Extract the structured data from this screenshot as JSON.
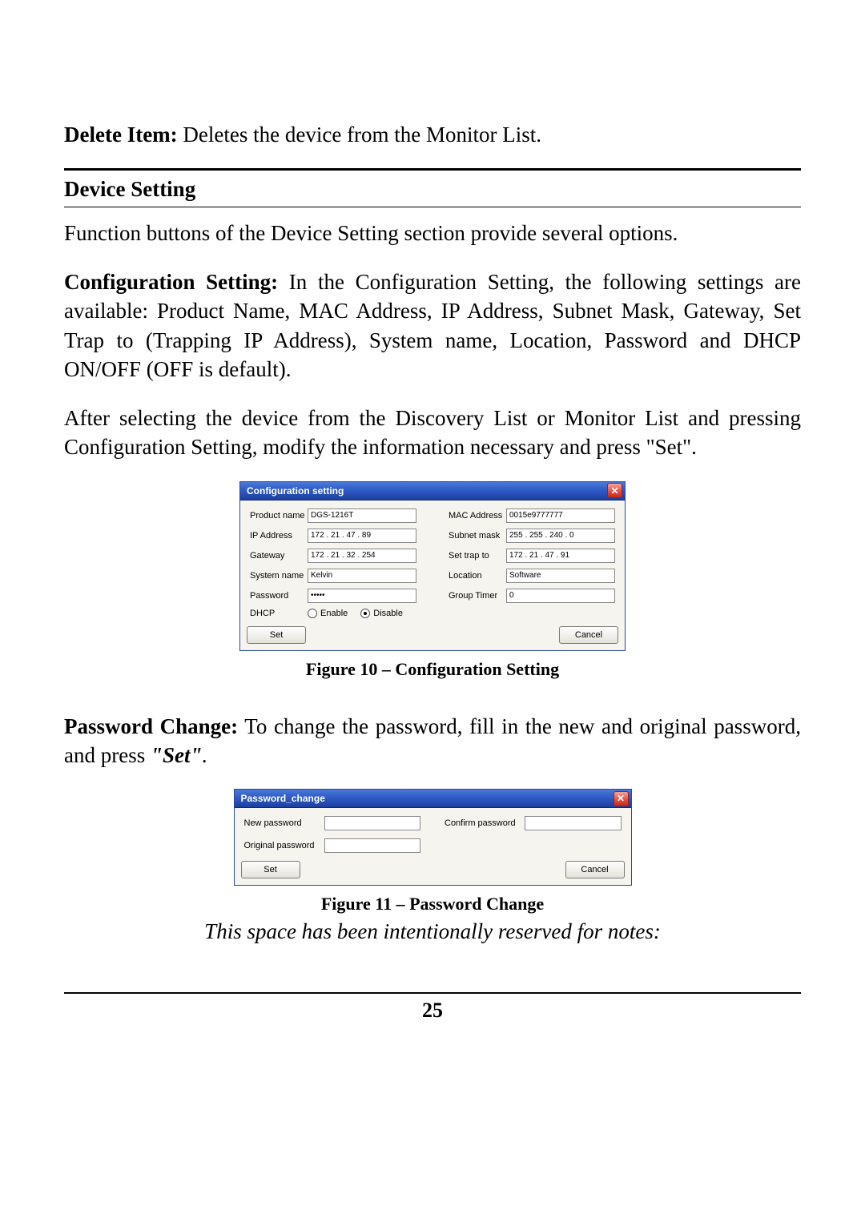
{
  "para_delete": {
    "label": "Delete Item:",
    "text": " Deletes the device from the Monitor List."
  },
  "section_title": "Device Setting",
  "para_intro": "Function buttons of the Device Setting section provide several options.",
  "para_config": {
    "label": "Configuration Setting:",
    "text": " In the Configuration Setting, the following settings are available: Product Name, MAC Address, IP Address, Subnet Mask, Gateway, Set Trap to (Trapping IP Address), System name, Location, Password and DHCP ON/OFF (OFF is default)."
  },
  "para_after": "After selecting the device from the Discovery List or Monitor List and pressing Configuration Setting, modify the information necessary and press \"Set\".",
  "config_dialog": {
    "title": "Configuration setting",
    "labels": {
      "product_name": "Product name",
      "mac": "MAC Address",
      "ip": "IP Address",
      "subnet": "Subnet mask",
      "gateway": "Gateway",
      "settrap": "Set trap to",
      "sysname": "System name",
      "location": "Location",
      "password": "Password",
      "grouptimer": "Group Timer",
      "dhcp": "DHCP",
      "enable": "Enable",
      "disable": "Disable"
    },
    "values": {
      "product_name": "DGS-1216T",
      "mac": "0015e9777777",
      "ip": "172 . 21 . 47 . 89",
      "subnet": "255 . 255 . 240 . 0",
      "gateway": "172 . 21 . 32 . 254",
      "settrap": "172 . 21 . 47 . 91",
      "sysname": "Kelvin",
      "location": "Software",
      "password": "•••••",
      "grouptimer": "0",
      "dhcp_selected": "disable"
    },
    "buttons": {
      "set": "Set",
      "cancel": "Cancel"
    }
  },
  "caption1": "Figure 10 – Configuration Setting",
  "para_pwd": {
    "label": "Password Change:",
    "text_prefix": " To change the password, fill in the new and original password, and press ",
    "set_italic": "\"Set\"",
    "period": "."
  },
  "pwd_dialog": {
    "title": "Password_change",
    "labels": {
      "new": "New password",
      "confirm": "Confirm password",
      "original": "Original password"
    },
    "buttons": {
      "set": "Set",
      "cancel": "Cancel"
    }
  },
  "caption2": "Figure 11 – Password Change",
  "notes_line": "This space has been intentionally reserved for notes:",
  "page_number": "25"
}
